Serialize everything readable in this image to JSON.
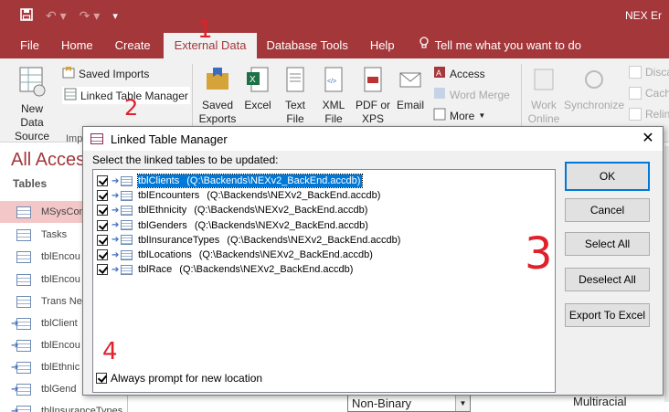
{
  "app": {
    "title": "NEX Er",
    "qat": {
      "save": "save-icon",
      "undo": "undo-icon",
      "redo": "redo-icon",
      "customize": "customize-icon"
    }
  },
  "tabs": [
    "File",
    "Home",
    "Create",
    "External Data",
    "Database Tools",
    "Help"
  ],
  "tell_me": "Tell me what you want to do",
  "ribbon": {
    "new_data_source": "New Data Source",
    "saved_imports": "Saved Imports",
    "linked_table_manager": "Linked Table Manager",
    "import_group": "Imp",
    "saved_exports": "Saved Exports",
    "excel": "Excel",
    "text_file": "Text File",
    "xml_file": "XML File",
    "pdf_xps": "PDF or XPS",
    "email": "Email",
    "access": "Access",
    "word_merge": "Word Merge",
    "more": "More",
    "work_online": "Work Online",
    "synchronize": "Synchronize",
    "discard": "Disca",
    "cache": "Cach",
    "relink": "Relin"
  },
  "nav": {
    "title": "All Acces",
    "category": "Tables",
    "items": [
      {
        "label": "MSysCom",
        "selected": true,
        "linked": false
      },
      {
        "label": "Tasks",
        "selected": false,
        "linked": false
      },
      {
        "label": "tblEncou",
        "selected": false,
        "linked": false
      },
      {
        "label": "tblEncou",
        "selected": false,
        "linked": false
      },
      {
        "label": "Trans Ne",
        "selected": false,
        "linked": false
      },
      {
        "label": "tblClient",
        "selected": false,
        "linked": true
      },
      {
        "label": "tblEncou",
        "selected": false,
        "linked": true
      },
      {
        "label": "tblEthnic",
        "selected": false,
        "linked": true
      },
      {
        "label": "tblGend",
        "selected": false,
        "linked": true
      },
      {
        "label": "tblInsuranceTypes",
        "selected": false,
        "linked": true
      }
    ]
  },
  "background": {
    "dropdown_value": "Non-Binary",
    "cell_value": "Multiracial"
  },
  "annotations": [
    "1",
    "2",
    "3",
    "4"
  ],
  "dialog": {
    "title": "Linked Table Manager",
    "prompt": "Select the linked tables to be updated:",
    "tables": [
      {
        "name": "tblClients",
        "path": "(Q:\\Backends\\NEXv2_BackEnd.accdb)",
        "checked": true,
        "selected": true
      },
      {
        "name": "tblEncounters",
        "path": "(Q:\\Backends\\NEXv2_BackEnd.accdb)",
        "checked": true,
        "selected": false
      },
      {
        "name": "tblEthnicity",
        "path": "(Q:\\Backends\\NEXv2_BackEnd.accdb)",
        "checked": true,
        "selected": false
      },
      {
        "name": "tblGenders",
        "path": "(Q:\\Backends\\NEXv2_BackEnd.accdb)",
        "checked": true,
        "selected": false
      },
      {
        "name": "tblInsuranceTypes",
        "path": "(Q:\\Backends\\NEXv2_BackEnd.accdb)",
        "checked": true,
        "selected": false
      },
      {
        "name": "tblLocations",
        "path": "(Q:\\Backends\\NEXv2_BackEnd.accdb)",
        "checked": true,
        "selected": false
      },
      {
        "name": "tblRace",
        "path": "(Q:\\Backends\\NEXv2_BackEnd.accdb)",
        "checked": true,
        "selected": false
      }
    ],
    "buttons": {
      "ok": "OK",
      "cancel": "Cancel",
      "select_all": "Select All",
      "deselect_all": "Deselect All",
      "export_to_excel": "Export To Excel"
    },
    "always_prompt": {
      "label": "Always prompt for new location",
      "checked": true
    }
  },
  "colors": {
    "accent": "#a4373a",
    "selection": "#0078d7",
    "annotation": "#e0202a"
  }
}
